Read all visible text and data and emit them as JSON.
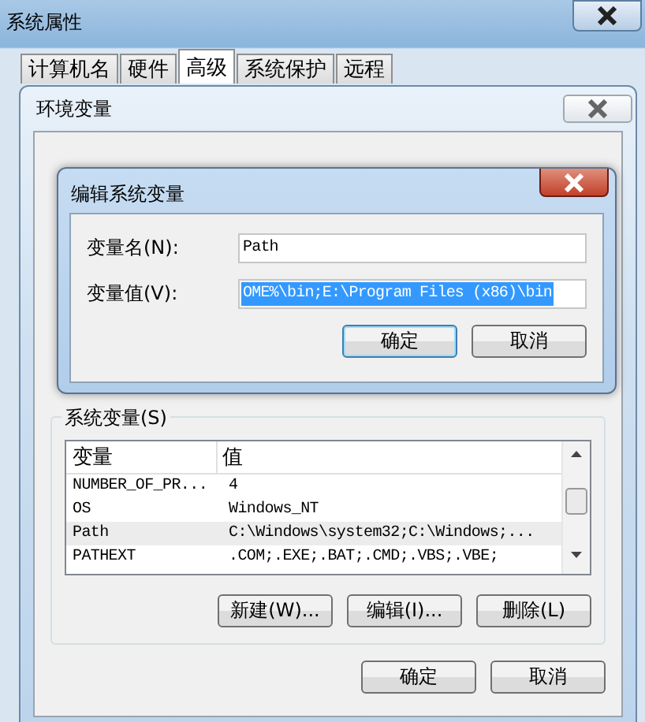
{
  "window": {
    "title": "系统属性"
  },
  "tabs": [
    {
      "label": "计算机名",
      "selected": false
    },
    {
      "label": "硬件",
      "selected": false
    },
    {
      "label": "高级",
      "selected": true
    },
    {
      "label": "系统保护",
      "selected": false
    },
    {
      "label": "远程",
      "selected": false
    }
  ],
  "env_dialog": {
    "title": "环境变量",
    "system_vars": {
      "label": "系统变量(S)",
      "columns": [
        "变量",
        "值"
      ],
      "rows": [
        {
          "name": "NUMBER_OF_PR...",
          "value": "4",
          "selected": false
        },
        {
          "name": "OS",
          "value": "Windows_NT",
          "selected": false
        },
        {
          "name": "Path",
          "value": "C:\\Windows\\system32;C:\\Windows;...",
          "selected": true
        },
        {
          "name": "PATHEXT",
          "value": ".COM;.EXE;.BAT;.CMD;.VBS;.VBE;",
          "selected": false
        }
      ],
      "buttons": [
        "新建(W)...",
        "编辑(I)...",
        "删除(L)"
      ]
    },
    "buttons": [
      "确定",
      "取消"
    ]
  },
  "edit_dialog": {
    "title": "编辑系统变量",
    "fields": [
      {
        "label": "变量名(N):",
        "value": "Path",
        "selected": false
      },
      {
        "label": "变量值(V):",
        "value": "OME%\\bin;E:\\Program Files (x86)\\bin",
        "selected": true
      }
    ],
    "buttons": [
      "确定",
      "取消"
    ]
  }
}
